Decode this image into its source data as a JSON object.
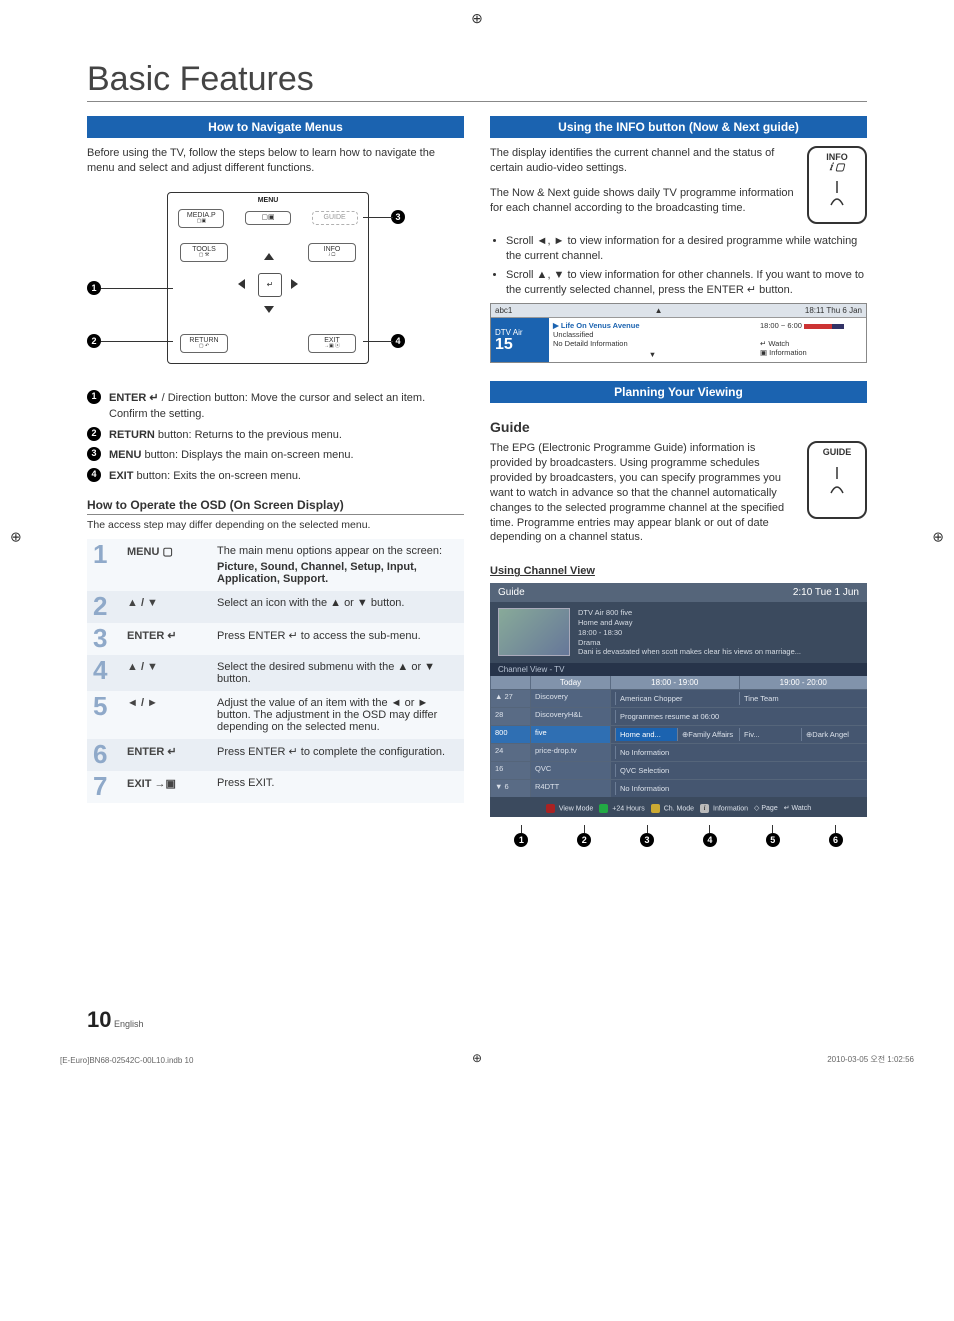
{
  "crop_symbol": "⊕",
  "title": "Basic Features",
  "left": {
    "section1_title": "How to Navigate Menus",
    "intro": "Before using the TV, follow the steps below to learn how to navigate the menu and select and adjust different functions.",
    "remote_labels": {
      "menu_title": "MENU",
      "media_p": "MEDIA.P",
      "menu": "▢▣",
      "guide": "GUIDE",
      "tools": "TOOLS",
      "info": "INFO",
      "return": "RETURN",
      "exit": "EXIT",
      "enter": "↵"
    },
    "callouts": {
      "n1": "1",
      "n2": "2",
      "n3": "3",
      "n4": "4"
    },
    "legend": [
      {
        "n": "1",
        "bold": "ENTER ↵",
        "text": " / Direction button: Move the cursor and select an item. Confirm the setting."
      },
      {
        "n": "2",
        "bold": "RETURN",
        "text": " button: Returns to the previous menu."
      },
      {
        "n": "3",
        "bold": "MENU",
        "text": " button: Displays the main on-screen menu."
      },
      {
        "n": "4",
        "bold": "EXIT",
        "text": " button: Exits the on-screen menu."
      }
    ],
    "osd_heading": "How to Operate the OSD (On Screen Display)",
    "osd_note": "The access step may differ depending on the selected menu.",
    "steps": [
      {
        "n": "1",
        "key": "MENU ▢",
        "text": "The main menu options appear on the screen:",
        "extra": "Picture, Sound, Channel, Setup, Input, Application, Support."
      },
      {
        "n": "2",
        "key": "▲ / ▼",
        "text": "Select an icon with the ▲ or ▼ button."
      },
      {
        "n": "3",
        "key": "ENTER ↵",
        "text": "Press ENTER ↵ to access the sub-menu."
      },
      {
        "n": "4",
        "key": "▲ / ▼",
        "text": "Select the desired submenu with the ▲ or ▼ button."
      },
      {
        "n": "5",
        "key": "◄ / ►",
        "text": "Adjust the value of an item with the ◄ or ► button. The adjustment in the OSD may differ depending on the selected menu."
      },
      {
        "n": "6",
        "key": "ENTER ↵",
        "text": "Press ENTER ↵ to complete the configuration."
      },
      {
        "n": "7",
        "key": "EXIT →▣",
        "text": "Press EXIT."
      }
    ]
  },
  "right": {
    "section2_title": "Using the INFO button (Now & Next guide)",
    "info_para1": "The display identifies the current channel and the status of certain audio-video settings.",
    "info_para2": "The Now & Next guide shows daily TV programme information for each channel according to the broadcasting time.",
    "info_label": "INFO",
    "bullets": [
      "Scroll ◄, ► to view information for a desired programme while watching the current channel.",
      "Scroll ▲, ▼ to view information for other channels. If you want to move to the currently selected channel, press the ENTER ↵ button."
    ],
    "nownext": {
      "hdr_left": "abc1",
      "hdr_arrow": "▲",
      "hdr_right": "18:11 Thu 6 Jan",
      "chan_service": "DTV Air",
      "chan_num": "15",
      "prog_title": "Life On Venus Avenue",
      "prog_class": "Unclassified",
      "prog_detail": "No Detaild Information",
      "time": "18:00 ~ 6:00",
      "watch": "↵ Watch",
      "info": "▣ Information",
      "arrow_down": "▼"
    },
    "section3_title": "Planning Your Viewing",
    "guide_heading": "Guide",
    "guide_para": "The EPG (Electronic Programme Guide) information is provided by broadcasters. Using programme schedules provided by broadcasters, you can specify programmes you want to watch in advance so that the channel automatically changes to the selected programme channel at the specified time. Programme entries may appear blank or out of date depending on a channel status.",
    "guide_label": "GUIDE",
    "channel_view_heading": "Using  Channel View",
    "guide_panel": {
      "title": "Guide",
      "clock": "2:10 Tue 1 Jun",
      "head_chan": "DTV Air 800 five",
      "head_prog": "Home and Away",
      "head_time": "18:00 - 18:30",
      "head_genre": "Drama",
      "head_desc": "Dani is devastated when scott makes clear his views on marriage...",
      "subbar": "Channel View - TV",
      "time_today": "Today",
      "time_col1": "18:00 - 19:00",
      "time_col2": "19:00 - 20:00",
      "rows": [
        {
          "up": "▲",
          "ch": "27",
          "name": "Discovery",
          "p": [
            "American Chopper",
            "Tine Team"
          ]
        },
        {
          "ch": "28",
          "name": "DiscoveryH&L",
          "p": [
            "Programmes resume at 06:00"
          ]
        },
        {
          "ch": "800",
          "name": "five",
          "p": [
            "Home and... ",
            "⊕Family Affairs",
            "Fiv...",
            "⊕Dark Angel"
          ],
          "active": true
        },
        {
          "ch": "24",
          "name": "price-drop.tv",
          "p": [
            "No Information"
          ]
        },
        {
          "ch": "16",
          "name": "QVC",
          "p": [
            "QVC Selection"
          ]
        },
        {
          "dn": "▼",
          "ch": "6",
          "name": "R4DTT",
          "p": [
            "No Information"
          ]
        }
      ],
      "footer": [
        {
          "k": "r",
          "t": "View Mode"
        },
        {
          "k": "g",
          "t": "+24 Hours"
        },
        {
          "k": "y",
          "t": "Ch. Mode"
        },
        {
          "k": "i",
          "t": "Information"
        },
        {
          "k": "",
          "t": "◇ Page"
        },
        {
          "k": "",
          "t": "↵ Watch"
        }
      ],
      "foot_nums": [
        "1",
        "2",
        "3",
        "4",
        "5",
        "6"
      ]
    }
  },
  "footer": {
    "page_num": "10",
    "lang": "English",
    "file": "[E-Euro]BN68-02542C-00L10.indb   10",
    "date": "2010-03-05   오전 1:02:56"
  }
}
